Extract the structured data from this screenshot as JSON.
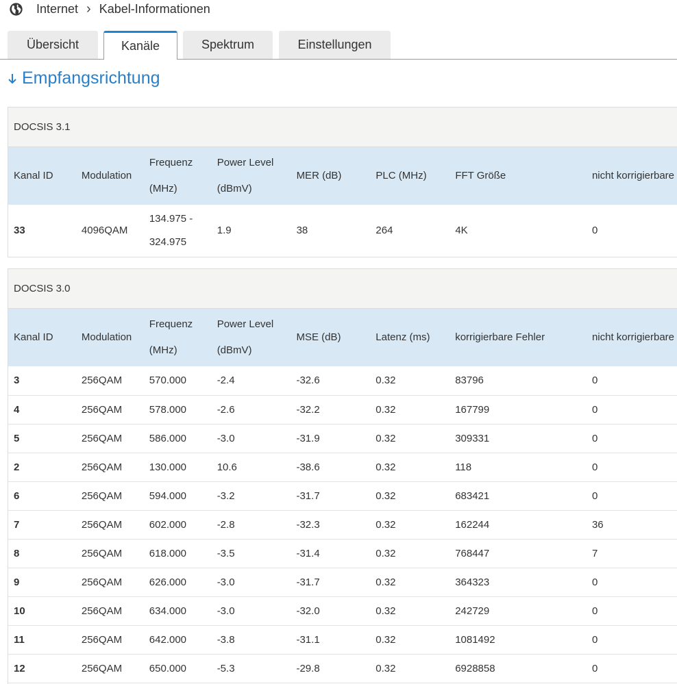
{
  "breadcrumb": {
    "icon": "globe-icon",
    "items": [
      "Internet",
      "Kabel-Informationen"
    ]
  },
  "tabs": [
    {
      "label": "Übersicht",
      "active": false
    },
    {
      "label": "Kanäle",
      "active": true
    },
    {
      "label": "Spektrum",
      "active": false
    },
    {
      "label": "Einstellungen",
      "active": false
    }
  ],
  "colors": {
    "accent": "#1c85d4",
    "title": "#2a80c8",
    "header_bg": "#d8e8f4",
    "panel_head_bg": "#f4f4f2"
  },
  "section": {
    "title": "Empfangsrichtung",
    "icon": "arrow-down-icon"
  },
  "docsis31": {
    "title": "DOCSIS 3.1",
    "columns": [
      "Kanal ID",
      "Modulation",
      "Frequenz (MHz)",
      "Power Level (dBmV)",
      "MER (dB)",
      "PLC (MHz)",
      "FFT Größe",
      "nicht korrigierbare"
    ],
    "rows": [
      [
        "33",
        "4096QAM",
        "134.975 - 324.975",
        "1.9",
        "38",
        "264",
        "4K",
        "0"
      ]
    ]
  },
  "docsis30": {
    "title": "DOCSIS 3.0",
    "columns": [
      "Kanal ID",
      "Modulation",
      "Frequenz (MHz)",
      "Power Level (dBmV)",
      "MSE (dB)",
      "Latenz (ms)",
      "korrigierbare Fehler",
      "nicht korrigierbare"
    ],
    "rows": [
      [
        "3",
        "256QAM",
        "570.000",
        "-2.4",
        "-32.6",
        "0.32",
        "83796",
        "0"
      ],
      [
        "4",
        "256QAM",
        "578.000",
        "-2.6",
        "-32.2",
        "0.32",
        "167799",
        "0"
      ],
      [
        "5",
        "256QAM",
        "586.000",
        "-3.0",
        "-31.9",
        "0.32",
        "309331",
        "0"
      ],
      [
        "2",
        "256QAM",
        "130.000",
        "10.6",
        "-38.6",
        "0.32",
        "118",
        "0"
      ],
      [
        "6",
        "256QAM",
        "594.000",
        "-3.2",
        "-31.7",
        "0.32",
        "683421",
        "0"
      ],
      [
        "7",
        "256QAM",
        "602.000",
        "-2.8",
        "-32.3",
        "0.32",
        "162244",
        "36"
      ],
      [
        "8",
        "256QAM",
        "618.000",
        "-3.5",
        "-31.4",
        "0.32",
        "768447",
        "7"
      ],
      [
        "9",
        "256QAM",
        "626.000",
        "-3.0",
        "-31.7",
        "0.32",
        "364323",
        "0"
      ],
      [
        "10",
        "256QAM",
        "634.000",
        "-3.0",
        "-32.0",
        "0.32",
        "242729",
        "0"
      ],
      [
        "11",
        "256QAM",
        "642.000",
        "-3.8",
        "-31.1",
        "0.32",
        "1081492",
        "0"
      ],
      [
        "12",
        "256QAM",
        "650.000",
        "-5.3",
        "-29.8",
        "0.32",
        "6928858",
        "0"
      ]
    ]
  }
}
